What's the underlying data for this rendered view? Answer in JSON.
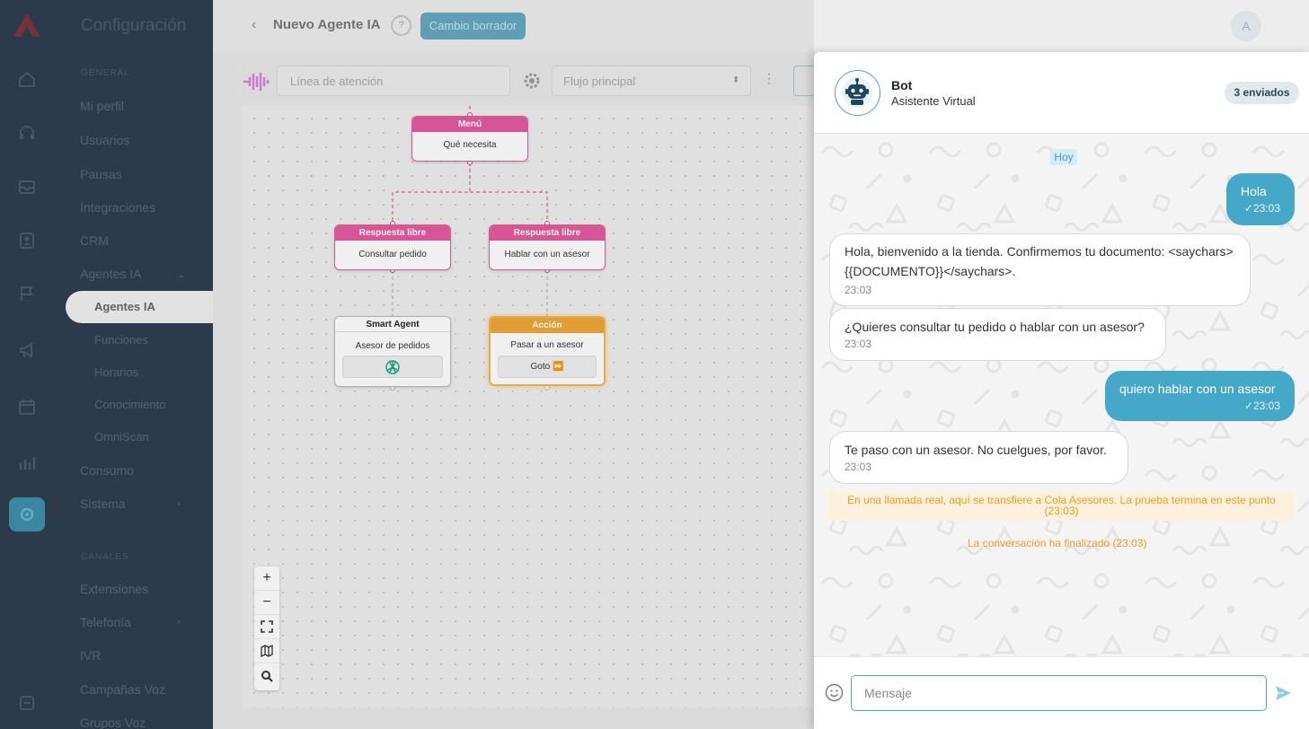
{
  "sidebar": {
    "title": "Configuración",
    "section_general": "GENERAL",
    "items": [
      {
        "label": "Mi perfil"
      },
      {
        "label": "Usuarios"
      },
      {
        "label": "Pausas"
      },
      {
        "label": "Integraciones"
      },
      {
        "label": "CRM"
      },
      {
        "label": "Agentes IA"
      },
      {
        "label": "Consumo"
      },
      {
        "label": "Sistema"
      }
    ],
    "sub_items": [
      {
        "label": "Agentes IA"
      },
      {
        "label": "Funciones"
      },
      {
        "label": "Horarios"
      },
      {
        "label": "Conocimiento"
      },
      {
        "label": "OmniScan"
      }
    ],
    "section_canales": "CANALES",
    "items2": [
      {
        "label": "Extensiones"
      },
      {
        "label": "Telefonía"
      },
      {
        "label": "IVR"
      },
      {
        "label": "Campañas Voz"
      },
      {
        "label": "Grupos Voz"
      }
    ],
    "icons": [
      "home-icon",
      "headset-icon",
      "inbox-icon",
      "contacts-icon",
      "flag-icon",
      "megaphone-icon",
      "calendar-icon",
      "stats-icon",
      "settings-icon",
      "logout-icon"
    ]
  },
  "header": {
    "title": "Nuevo Agente IA",
    "help": "?",
    "draft_label": "Cambio borrador",
    "avatar": "A"
  },
  "toolbar": {
    "line_placeholder": "Línea de atención",
    "flow_value": "Flujo principal"
  },
  "flow": {
    "menu": {
      "header": "Menú",
      "body": "Qué necesita"
    },
    "free1": {
      "header": "Respuesta libre",
      "body": "Consultar pedido"
    },
    "free2": {
      "header": "Respuesta libre",
      "body": "Hablar con un asesor"
    },
    "smart": {
      "header": "Smart Agent",
      "body": "Asesor de pedidos"
    },
    "action": {
      "header": "Acción",
      "body": "Pasar a un asesor",
      "button": "Goto ⏩"
    }
  },
  "zoom_controls": [
    "zoom-in",
    "zoom-out",
    "fit-view",
    "minimap",
    "search"
  ],
  "chat": {
    "bot_name": "Bot",
    "bot_subtitle": "Asistente Virtual",
    "sent_badge": "3 enviados",
    "day_label": "Hoy",
    "messages": [
      {
        "dir": "out",
        "text": "Hola",
        "time": "✓23:03"
      },
      {
        "dir": "in",
        "text": "Hola, bienvenido a la tienda. Confirmemos tu documento: <saychars>{{DOCUMENTO}}</saychars>.",
        "time": "23:03"
      },
      {
        "dir": "in",
        "text": "¿Quieres consultar tu pedido o hablar con un asesor?",
        "time": "23:03"
      },
      {
        "dir": "out",
        "text": "quiero hablar con un asesor",
        "time": "✓23:03"
      },
      {
        "dir": "in",
        "text": "Te paso con un asesor. No cuelgues, por favor.",
        "time": "23:03"
      }
    ],
    "system_transfer": "En una llamada real, aquí se transfiere a Cola Asesores. La prueba termina en este punto (23:03)",
    "system_end": "La conversación ha finalizado (23:03)",
    "input_placeholder": "Mensaje"
  },
  "colors": {
    "sidebar_bg": "#2d3d4f",
    "accent": "#45a8c9",
    "node_pink": "#e45a9e",
    "node_orange": "#f0a535",
    "system_text": "#ee9d22"
  }
}
